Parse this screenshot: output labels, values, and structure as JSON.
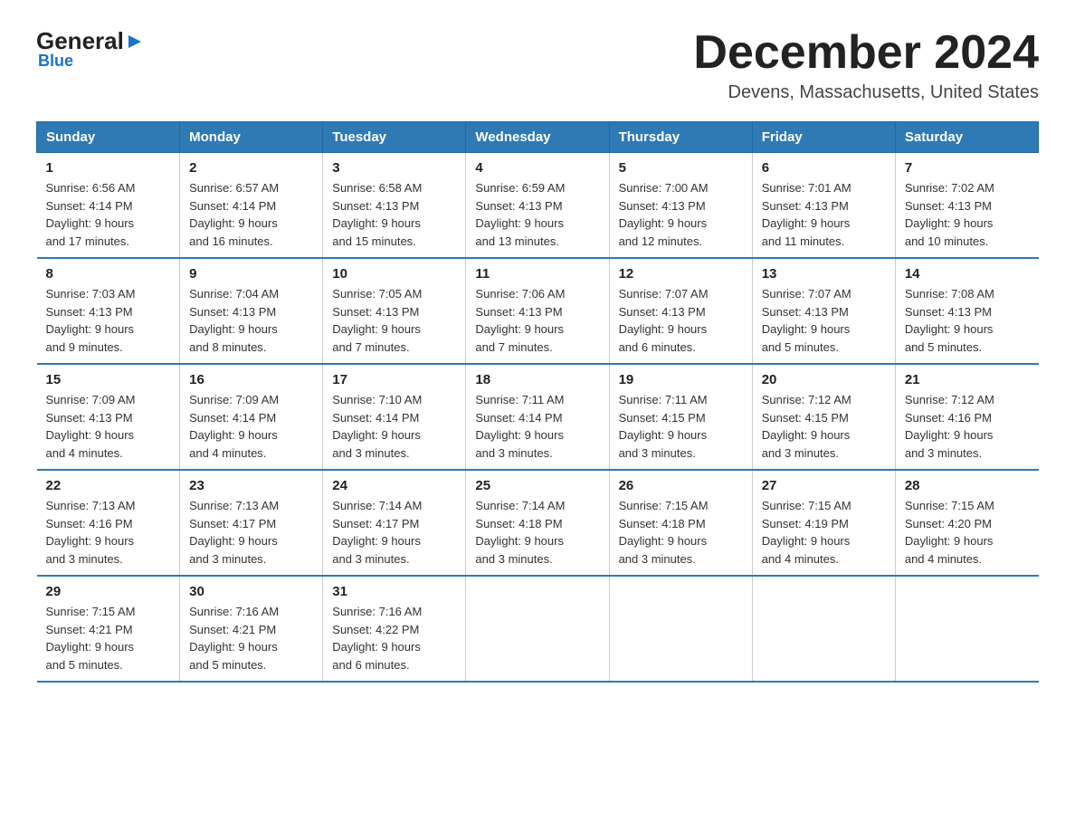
{
  "header": {
    "logo_general": "General",
    "logo_blue": "Blue",
    "title": "December 2024",
    "subtitle": "Devens, Massachusetts, United States"
  },
  "days_of_week": [
    "Sunday",
    "Monday",
    "Tuesday",
    "Wednesday",
    "Thursday",
    "Friday",
    "Saturday"
  ],
  "weeks": [
    [
      {
        "day": "1",
        "sunrise": "6:56 AM",
        "sunset": "4:14 PM",
        "daylight": "9 hours and 17 minutes."
      },
      {
        "day": "2",
        "sunrise": "6:57 AM",
        "sunset": "4:14 PM",
        "daylight": "9 hours and 16 minutes."
      },
      {
        "day": "3",
        "sunrise": "6:58 AM",
        "sunset": "4:13 PM",
        "daylight": "9 hours and 15 minutes."
      },
      {
        "day": "4",
        "sunrise": "6:59 AM",
        "sunset": "4:13 PM",
        "daylight": "9 hours and 13 minutes."
      },
      {
        "day": "5",
        "sunrise": "7:00 AM",
        "sunset": "4:13 PM",
        "daylight": "9 hours and 12 minutes."
      },
      {
        "day": "6",
        "sunrise": "7:01 AM",
        "sunset": "4:13 PM",
        "daylight": "9 hours and 11 minutes."
      },
      {
        "day": "7",
        "sunrise": "7:02 AM",
        "sunset": "4:13 PM",
        "daylight": "9 hours and 10 minutes."
      }
    ],
    [
      {
        "day": "8",
        "sunrise": "7:03 AM",
        "sunset": "4:13 PM",
        "daylight": "9 hours and 9 minutes."
      },
      {
        "day": "9",
        "sunrise": "7:04 AM",
        "sunset": "4:13 PM",
        "daylight": "9 hours and 8 minutes."
      },
      {
        "day": "10",
        "sunrise": "7:05 AM",
        "sunset": "4:13 PM",
        "daylight": "9 hours and 7 minutes."
      },
      {
        "day": "11",
        "sunrise": "7:06 AM",
        "sunset": "4:13 PM",
        "daylight": "9 hours and 7 minutes."
      },
      {
        "day": "12",
        "sunrise": "7:07 AM",
        "sunset": "4:13 PM",
        "daylight": "9 hours and 6 minutes."
      },
      {
        "day": "13",
        "sunrise": "7:07 AM",
        "sunset": "4:13 PM",
        "daylight": "9 hours and 5 minutes."
      },
      {
        "day": "14",
        "sunrise": "7:08 AM",
        "sunset": "4:13 PM",
        "daylight": "9 hours and 5 minutes."
      }
    ],
    [
      {
        "day": "15",
        "sunrise": "7:09 AM",
        "sunset": "4:13 PM",
        "daylight": "9 hours and 4 minutes."
      },
      {
        "day": "16",
        "sunrise": "7:09 AM",
        "sunset": "4:14 PM",
        "daylight": "9 hours and 4 minutes."
      },
      {
        "day": "17",
        "sunrise": "7:10 AM",
        "sunset": "4:14 PM",
        "daylight": "9 hours and 3 minutes."
      },
      {
        "day": "18",
        "sunrise": "7:11 AM",
        "sunset": "4:14 PM",
        "daylight": "9 hours and 3 minutes."
      },
      {
        "day": "19",
        "sunrise": "7:11 AM",
        "sunset": "4:15 PM",
        "daylight": "9 hours and 3 minutes."
      },
      {
        "day": "20",
        "sunrise": "7:12 AM",
        "sunset": "4:15 PM",
        "daylight": "9 hours and 3 minutes."
      },
      {
        "day": "21",
        "sunrise": "7:12 AM",
        "sunset": "4:16 PM",
        "daylight": "9 hours and 3 minutes."
      }
    ],
    [
      {
        "day": "22",
        "sunrise": "7:13 AM",
        "sunset": "4:16 PM",
        "daylight": "9 hours and 3 minutes."
      },
      {
        "day": "23",
        "sunrise": "7:13 AM",
        "sunset": "4:17 PM",
        "daylight": "9 hours and 3 minutes."
      },
      {
        "day": "24",
        "sunrise": "7:14 AM",
        "sunset": "4:17 PM",
        "daylight": "9 hours and 3 minutes."
      },
      {
        "day": "25",
        "sunrise": "7:14 AM",
        "sunset": "4:18 PM",
        "daylight": "9 hours and 3 minutes."
      },
      {
        "day": "26",
        "sunrise": "7:15 AM",
        "sunset": "4:18 PM",
        "daylight": "9 hours and 3 minutes."
      },
      {
        "day": "27",
        "sunrise": "7:15 AM",
        "sunset": "4:19 PM",
        "daylight": "9 hours and 4 minutes."
      },
      {
        "day": "28",
        "sunrise": "7:15 AM",
        "sunset": "4:20 PM",
        "daylight": "9 hours and 4 minutes."
      }
    ],
    [
      {
        "day": "29",
        "sunrise": "7:15 AM",
        "sunset": "4:21 PM",
        "daylight": "9 hours and 5 minutes."
      },
      {
        "day": "30",
        "sunrise": "7:16 AM",
        "sunset": "4:21 PM",
        "daylight": "9 hours and 5 minutes."
      },
      {
        "day": "31",
        "sunrise": "7:16 AM",
        "sunset": "4:22 PM",
        "daylight": "9 hours and 6 minutes."
      },
      null,
      null,
      null,
      null
    ]
  ],
  "labels": {
    "sunrise": "Sunrise:",
    "sunset": "Sunset:",
    "daylight": "Daylight:"
  }
}
